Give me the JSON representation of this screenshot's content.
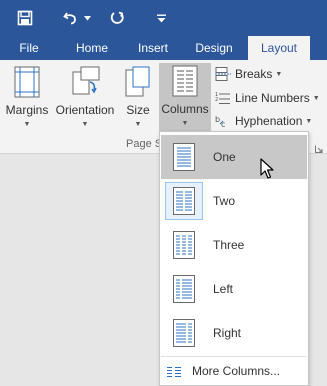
{
  "quick_access": {
    "save_icon": "save-icon",
    "undo_icon": "undo-icon",
    "undo_dropdown_icon": "chevron-down-icon",
    "redo_icon": "redo-icon",
    "customize_icon": "customize-qat-icon"
  },
  "tabs": [
    {
      "label": "File"
    },
    {
      "label": "Home"
    },
    {
      "label": "Insert"
    },
    {
      "label": "Design"
    },
    {
      "label": "Layout",
      "active": true
    }
  ],
  "ribbon": {
    "margins_label": "Margins",
    "orientation_label": "Orientation",
    "size_label": "Size",
    "columns_label": "Columns",
    "breaks_label": "Breaks",
    "line_numbers_label": "Line Numbers",
    "hyphenation_label": "Hyphenation",
    "group_label": "Page S"
  },
  "columns_menu": {
    "items": [
      {
        "label": "One",
        "highlighted": true
      },
      {
        "label": "Two",
        "selected": true
      },
      {
        "label": "Three"
      },
      {
        "label": "Left"
      },
      {
        "label": "Right"
      }
    ],
    "more_label": "More Columns..."
  },
  "colors": {
    "brand_blue": "#2b579a",
    "ribbon_bg": "#f3f3f3",
    "hover_gray": "#c8c8c8",
    "selected_border": "#9cc6e8"
  }
}
